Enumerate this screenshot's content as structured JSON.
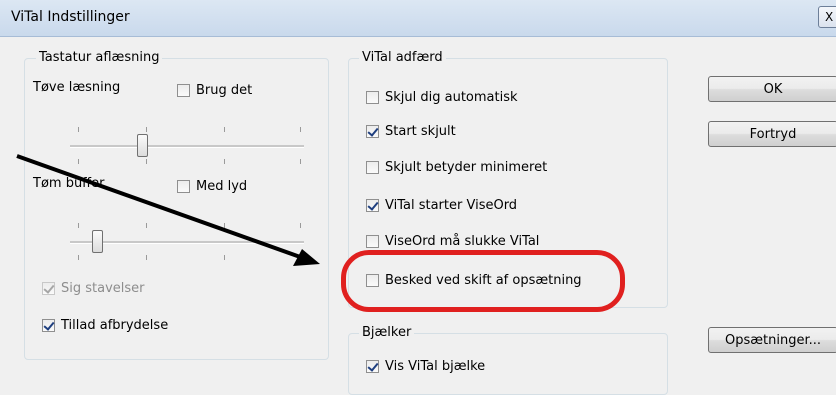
{
  "window": {
    "title": "ViTal Indstillinger",
    "close_label": "X"
  },
  "tastatur": {
    "legend": "Tastatur aflæsning",
    "tove_label": "Tøve læsning",
    "brug_det": {
      "label": "Brug det",
      "checked": false
    },
    "tove_slider_level": 0.3,
    "tom_label": "Tøm buffer",
    "med_lyd": {
      "label": "Med lyd",
      "checked": false
    },
    "tom_slider_level": 0.1,
    "sig_stavelser": {
      "label": "Sig stavelser",
      "checked": true,
      "disabled": true
    },
    "tillad_afbrydelse": {
      "label": "Tillad afbrydelse",
      "checked": true
    }
  },
  "adfaerd": {
    "legend": "ViTal adfærd",
    "items": [
      {
        "label": "Skjul dig automatisk",
        "checked": false
      },
      {
        "label": "Start skjult",
        "checked": true
      },
      {
        "label": "Skjult betyder minimeret",
        "checked": false
      },
      {
        "label": "ViTal starter ViseOrd",
        "checked": true
      },
      {
        "label": "ViseOrd må slukke ViTal",
        "checked": false
      },
      {
        "label": "Besked ved skift af opsætning",
        "checked": false
      }
    ]
  },
  "bjaelker": {
    "legend": "Bjælker",
    "partial_item": {
      "label": "Vis ViTal bjælke",
      "checked": true
    }
  },
  "buttons": {
    "ok": "OK",
    "fortryd": "Fortryd",
    "opsaetninger": "Opsætninger..."
  },
  "annotation": {
    "highlight_color": "#e0201f",
    "arrow_color": "#000000"
  }
}
